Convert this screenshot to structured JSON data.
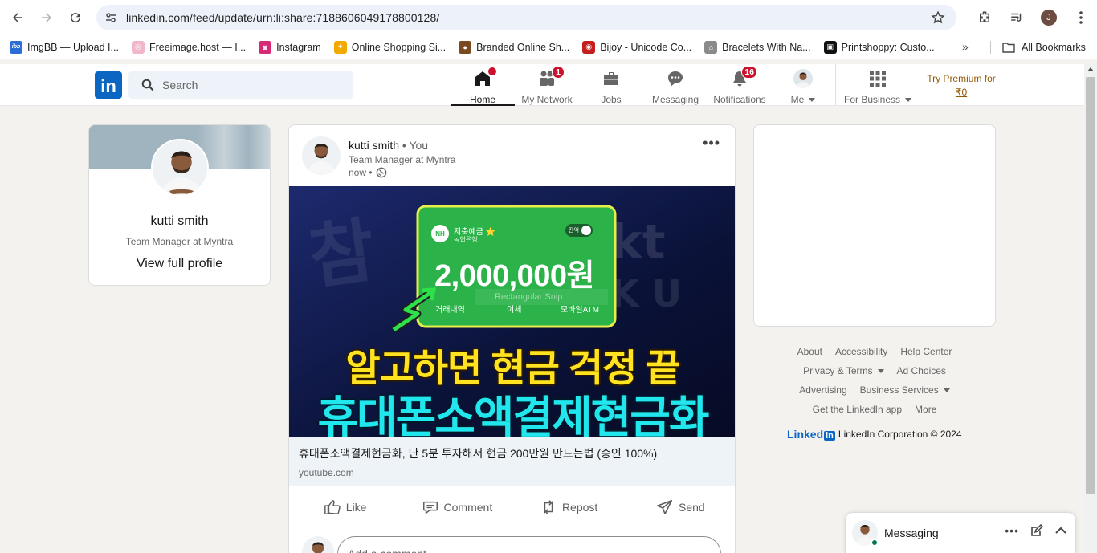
{
  "browser": {
    "url": "linkedin.com/feed/update/urn:li:share:7188606049178800128/",
    "profile_initial": "J",
    "bookmarks": [
      {
        "label": "ImgBB — Upload I...",
        "icon": "imgbb-icon",
        "color": "#2a6dd6",
        "glyph": "ibb"
      },
      {
        "label": "Freeimage.host — I...",
        "icon": "freeimage-icon",
        "color": "#f2b6c9",
        "glyph": "◎"
      },
      {
        "label": "Instagram",
        "icon": "instagram-icon",
        "color": "#d62976",
        "glyph": "◙"
      },
      {
        "label": "Online Shopping Si...",
        "icon": "shopping-icon",
        "color": "#f2a900",
        "glyph": "✦"
      },
      {
        "label": "Branded Online Sh...",
        "icon": "branded-icon",
        "color": "#7a4a1e",
        "glyph": "●"
      },
      {
        "label": "Bijoy - Unicode Co...",
        "icon": "bijoy-icon",
        "color": "#c41e1e",
        "glyph": "◉"
      },
      {
        "label": "Bracelets With Na...",
        "icon": "bracelets-icon",
        "color": "#8a8a8a",
        "glyph": "⌂"
      },
      {
        "label": "Printshoppy: Custo...",
        "icon": "printshoppy-icon",
        "color": "#111111",
        "glyph": "▣"
      }
    ],
    "all_bookmarks": "All Bookmarks"
  },
  "linkedin": {
    "logo_text": "in",
    "search_placeholder": "Search",
    "nav": [
      {
        "label": "Home",
        "icon": "home-icon",
        "badge": "",
        "dot": true,
        "active": true
      },
      {
        "label": "My Network",
        "icon": "network-icon",
        "badge": "1"
      },
      {
        "label": "Jobs",
        "icon": "jobs-icon",
        "badge": ""
      },
      {
        "label": "Messaging",
        "icon": "messaging-icon",
        "badge": ""
      },
      {
        "label": "Notifications",
        "icon": "bell-icon",
        "badge": "16"
      },
      {
        "label": "Me",
        "icon": "me-avatar",
        "badge": ""
      },
      {
        "label": "For Business",
        "icon": "grid-icon",
        "badge": ""
      }
    ],
    "premium_line1": "Try Premium for",
    "premium_line2": "₹0",
    "brand_color": "#0a66c2",
    "badge_color": "#cb112d"
  },
  "profile": {
    "name": "kutti smith",
    "headline": "Team Manager at Myntra",
    "view_profile": "View full profile"
  },
  "post": {
    "author": "kutti smith",
    "relation": "• You",
    "headline": "Team Manager at Myntra",
    "time": "now •",
    "image": {
      "bank_name": "저축예금 ⭐",
      "bank_sub": "농협은행",
      "bank_logo": "NH",
      "toggle_label": "잔액",
      "amount": "2,000,000원",
      "tab1": "거래내역",
      "tab2": "이체",
      "tab3": "모바일ATM",
      "snip_label": "Rectangular Snip",
      "headline_yellow": "알고하면 현금 걱정 끝",
      "headline_cyan": "휴대폰소액결제현금화"
    },
    "link_title": "휴대폰소액결제현금화, 단 5분 투자해서 현금 200만원 만드는법 (승인 100%)",
    "link_domain": "youtube.com",
    "actions": [
      "Like",
      "Comment",
      "Repost",
      "Send"
    ],
    "comment_placeholder": "Add a comment..."
  },
  "footer": {
    "row1": [
      "About",
      "Accessibility",
      "Help Center"
    ],
    "row2_a": "Privacy & Terms",
    "row2_b": "Ad Choices",
    "row3_a": "Advertising",
    "row3_b": "Business Services",
    "row4": [
      "Get the LinkedIn app",
      "More"
    ],
    "brand_word": "Linked",
    "brand_in": "in",
    "copyright": "LinkedIn Corporation © 2024"
  },
  "messaging": {
    "title": "Messaging"
  }
}
